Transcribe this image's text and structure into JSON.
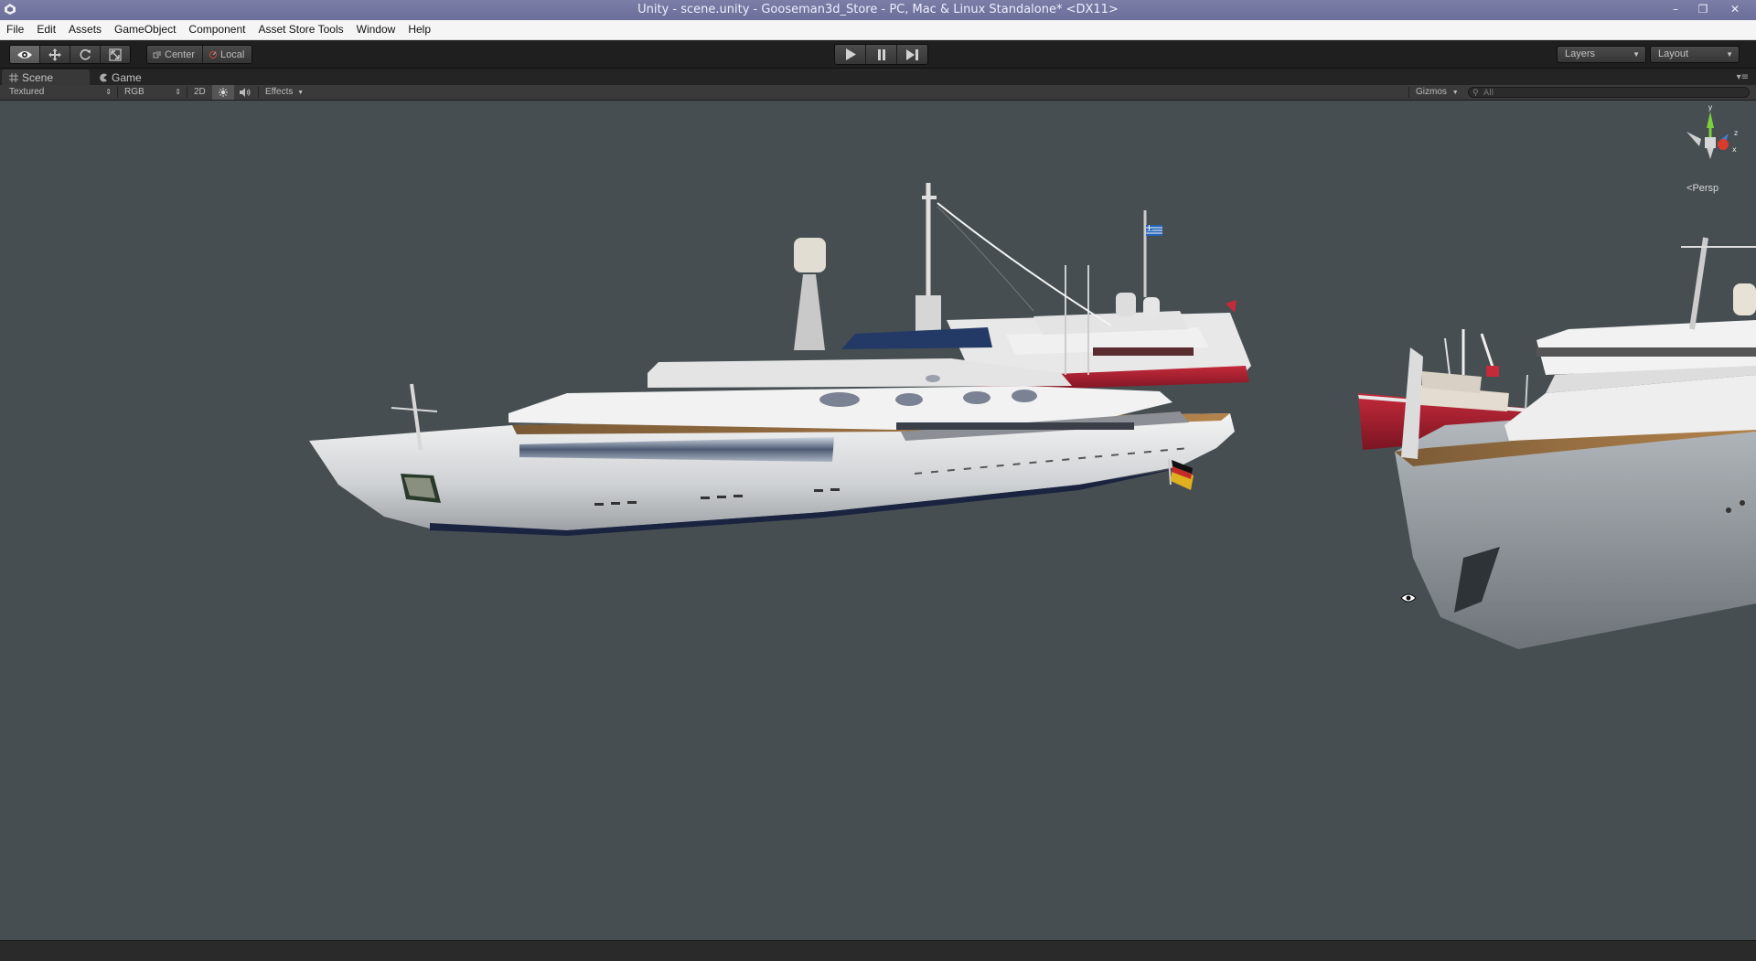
{
  "window": {
    "title": "Unity - scene.unity - Gooseman3d_Store - PC, Mac & Linux Standalone* <DX11>",
    "app_icon": "unity-logo-icon",
    "minimize_icon": "–",
    "maximize_icon": "❐",
    "close_icon": "✕"
  },
  "menu": {
    "items": [
      "File",
      "Edit",
      "Assets",
      "GameObject",
      "Component",
      "Asset Store Tools",
      "Window",
      "Help"
    ]
  },
  "toolbar": {
    "transform_tools": [
      "view-hand-icon",
      "move-icon",
      "rotate-icon",
      "scale-icon"
    ],
    "active_tool": "view-hand-icon",
    "pivot_mode": "Center",
    "pivot_rotation": "Local",
    "play_controls": [
      "play-icon",
      "pause-icon",
      "step-icon"
    ],
    "layers_label": "Layers",
    "layout_label": "Layout"
  },
  "tabs": {
    "scene_label": "Scene",
    "game_label": "Game",
    "active": "Scene"
  },
  "scene_bar": {
    "draw_mode": "Textured",
    "render_mode": "RGB",
    "mode_2d": "2D",
    "lighting_icon": "sun-icon",
    "audio_icon": "speaker-icon",
    "effects_label": "Effects",
    "gizmos_label": "Gizmos",
    "search_placeholder": "All"
  },
  "viewport": {
    "background_color": "#464e51",
    "projection_label": "Persp",
    "gizmo_axes": {
      "y": "y",
      "z": "z",
      "x": "x"
    },
    "objects": [
      "white-superyacht",
      "red-white-yacht",
      "red-expedition-ship",
      "partial-white-yacht"
    ],
    "flags": [
      "greece-flag",
      "germany-flag"
    ]
  },
  "colors": {
    "titlebar": "#6a6e98",
    "toolbar": "#1f1f1f",
    "axis_y": "#7ccf3e",
    "axis_z": "#4a7ccf",
    "axis_x": "#d93c2c"
  }
}
